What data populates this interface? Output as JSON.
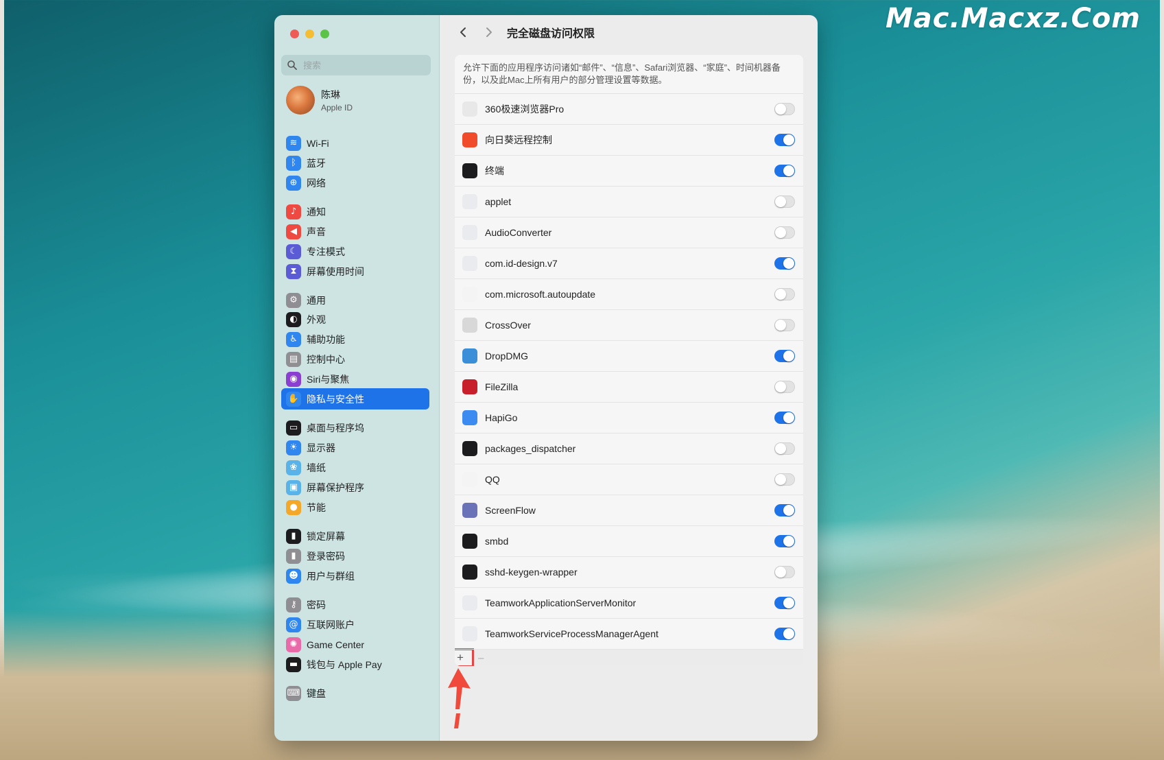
{
  "watermark": "Mac.Macxz.Com",
  "sidebar": {
    "search_placeholder": "搜索",
    "profile": {
      "name": "陈琳",
      "subtitle": "Apple ID"
    },
    "items": [
      {
        "label": "Wi-Fi",
        "icon": "wifi-icon",
        "color": "#2f86ef",
        "glyph": "≋"
      },
      {
        "label": "蓝牙",
        "icon": "bluetooth-icon",
        "color": "#2f86ef",
        "glyph": "ᛒ"
      },
      {
        "label": "网络",
        "icon": "globe-icon",
        "color": "#2f86ef",
        "glyph": "⊕"
      },
      {
        "label": "通知",
        "icon": "bell-icon",
        "color": "#ef4a42",
        "glyph": "♪"
      },
      {
        "label": "声音",
        "icon": "speaker-icon",
        "color": "#ef4a42",
        "glyph": "◀"
      },
      {
        "label": "专注模式",
        "icon": "moon-icon",
        "color": "#5b5bd6",
        "glyph": "☾"
      },
      {
        "label": "屏幕使用时间",
        "icon": "hourglass-icon",
        "color": "#5b5bd6",
        "glyph": "⧗"
      },
      {
        "label": "通用",
        "icon": "gear-icon",
        "color": "#8e8e93",
        "glyph": "⚙"
      },
      {
        "label": "外观",
        "icon": "appearance-icon",
        "color": "#1c1c1e",
        "glyph": "◐"
      },
      {
        "label": "辅助功能",
        "icon": "accessibility-icon",
        "color": "#2f86ef",
        "glyph": "♿"
      },
      {
        "label": "控制中心",
        "icon": "control-center-icon",
        "color": "#8e8e93",
        "glyph": "▤"
      },
      {
        "label": "Siri与聚焦",
        "icon": "siri-icon",
        "color": "#8a3fd1",
        "glyph": "◉"
      },
      {
        "label": "隐私与安全性",
        "icon": "hand-icon",
        "color": "#2f86ef",
        "glyph": "✋"
      },
      {
        "label": "桌面与程序坞",
        "icon": "dock-icon",
        "color": "#1c1c1e",
        "glyph": "▭"
      },
      {
        "label": "显示器",
        "icon": "sun-icon",
        "color": "#2f86ef",
        "glyph": "☀"
      },
      {
        "label": "墙纸",
        "icon": "wallpaper-icon",
        "color": "#5ab3e8",
        "glyph": "❀"
      },
      {
        "label": "屏幕保护程序",
        "icon": "screensaver-icon",
        "color": "#5ab3e8",
        "glyph": "▣"
      },
      {
        "label": "节能",
        "icon": "bulb-icon",
        "color": "#f4a829",
        "glyph": "●"
      },
      {
        "label": "锁定屏幕",
        "icon": "lock-icon",
        "color": "#1c1c1e",
        "glyph": "▮"
      },
      {
        "label": "登录密码",
        "icon": "lock-small-icon",
        "color": "#8e8e93",
        "glyph": "▮"
      },
      {
        "label": "用户与群组",
        "icon": "users-icon",
        "color": "#2f86ef",
        "glyph": "☻"
      },
      {
        "label": "密码",
        "icon": "key-icon",
        "color": "#8e8e93",
        "glyph": "⚷"
      },
      {
        "label": "互联网账户",
        "icon": "at-icon",
        "color": "#2f86ef",
        "glyph": "@"
      },
      {
        "label": "Game Center",
        "icon": "game-center-icon",
        "color": "#e86aa8",
        "glyph": "✺"
      },
      {
        "label": "钱包与 Apple Pay",
        "icon": "wallet-icon",
        "color": "#1c1c1e",
        "glyph": "▬"
      },
      {
        "label": "键盘",
        "icon": "keyboard-icon",
        "color": "#8e8e93",
        "glyph": "⌨"
      }
    ],
    "active_index": 12
  },
  "main": {
    "title": "完全磁盘访问权限",
    "description": "允许下面的应用程序访问诸如“邮件”、“信息”、Safari浏览器、“家庭”、时间机器备份，以及此Mac上所有用户的部分管理设置等数据。",
    "apps": [
      {
        "name": "360极速浏览器Pro",
        "icon": "browser-360-icon",
        "color": "#e8e8e8",
        "enabled": false
      },
      {
        "name": "向日葵远程控制",
        "icon": "sunflower-icon",
        "color": "#f04b2a",
        "enabled": true
      },
      {
        "name": "终端",
        "icon": "terminal-icon",
        "color": "#1c1c1e",
        "enabled": true
      },
      {
        "name": "applet",
        "icon": "generic-app-icon",
        "color": "#e9ebee",
        "enabled": false
      },
      {
        "name": "AudioConverter",
        "icon": "generic-app-icon",
        "color": "#e9ebee",
        "enabled": false
      },
      {
        "name": "com.id-design.v7",
        "icon": "generic-app-icon",
        "color": "#e9ebee",
        "enabled": true
      },
      {
        "name": "com.microsoft.autoupdate",
        "icon": "document-icon",
        "color": "#f4f4f4",
        "enabled": false
      },
      {
        "name": "CrossOver",
        "icon": "crossover-icon",
        "color": "#d8d8d8",
        "enabled": false
      },
      {
        "name": "DropDMG",
        "icon": "dropdmg-icon",
        "color": "#3a8fd8",
        "enabled": true
      },
      {
        "name": "FileZilla",
        "icon": "filezilla-icon",
        "color": "#c8202a",
        "enabled": false
      },
      {
        "name": "HapiGo",
        "icon": "hapigo-icon",
        "color": "#3b8bf0",
        "enabled": true
      },
      {
        "name": "packages_dispatcher",
        "icon": "exec-icon",
        "color": "#1c1c1e",
        "enabled": false
      },
      {
        "name": "QQ",
        "icon": "qq-penguin-icon",
        "color": "#f4f4f4",
        "enabled": false
      },
      {
        "name": "ScreenFlow",
        "icon": "screenflow-icon",
        "color": "#6a72b8",
        "enabled": true
      },
      {
        "name": "smbd",
        "icon": "exec-icon",
        "color": "#1c1c1e",
        "enabled": true
      },
      {
        "name": "sshd-keygen-wrapper",
        "icon": "exec-icon",
        "color": "#1c1c1e",
        "enabled": false
      },
      {
        "name": "TeamworkApplicationServerMonitor",
        "icon": "generic-app-icon",
        "color": "#e9ebee",
        "enabled": true
      },
      {
        "name": "TeamworkServiceProcessManagerAgent",
        "icon": "generic-app-icon",
        "color": "#e9ebee",
        "enabled": true
      }
    ],
    "footer": {
      "add": "+",
      "remove": "–"
    }
  }
}
